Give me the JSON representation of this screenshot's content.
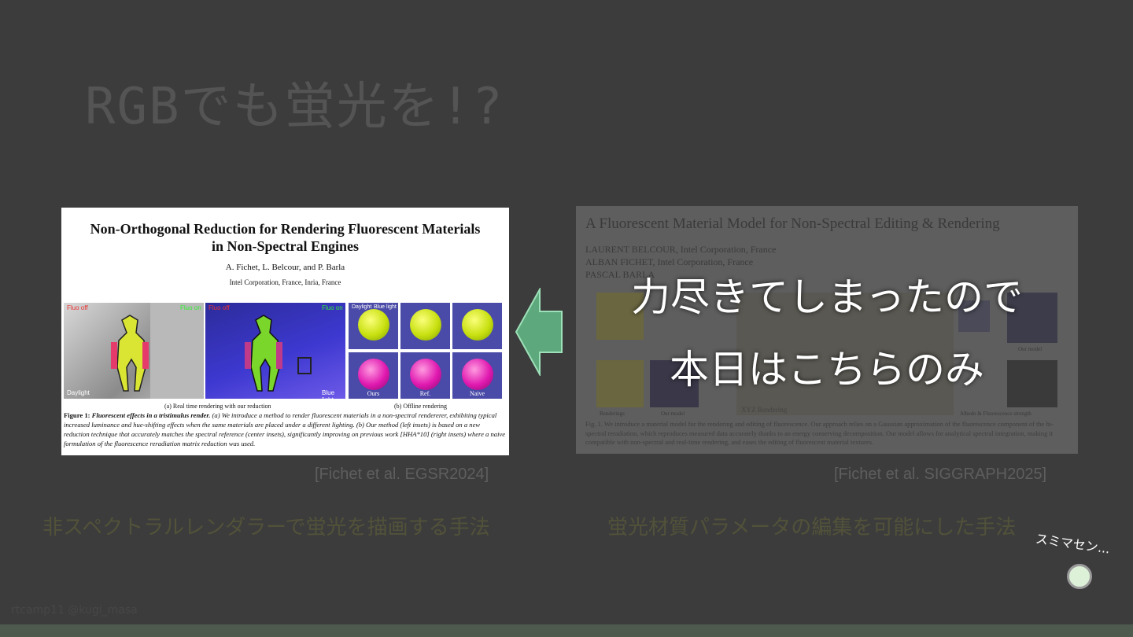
{
  "slide": {
    "title": "RGBでも蛍光を!?",
    "credit": "rtcamp11 @kugi_masa",
    "overlay_line1": "力尽きてしまったので",
    "overlay_line2": "本日はこちらのみ",
    "sorry_note": "スミマセン...",
    "colors": {
      "background": "#3c3c3c",
      "arrow": "#5ea87e",
      "bottom_bar": "#4e5a4e"
    }
  },
  "left_paper": {
    "title_line1": "Non-Orthogonal Reduction for Rendering Fluorescent Materials",
    "title_line2": "in Non-Spectral Engines",
    "authors": "A. Fichet, L. Belcour, and P. Barla",
    "affiliations": "Intel Corporation, France, Inria, France",
    "labels": {
      "fluo_off_a": "Fluo off",
      "fluo_on_a": "Fluo on",
      "fluo_off_b": "Fluo off",
      "fluo_on_b": "Fluo on",
      "daylight": "Daylight",
      "blue_light": "Blue light",
      "ours": "Ours",
      "ref": "Ref.",
      "naive": "Naive",
      "sphere_top_left": "Daylight",
      "sphere_top_right": "Blue light"
    },
    "subcaption_a": "(a) Real time rendering with our reduction",
    "subcaption_b": "(b) Offline rendering",
    "caption_head": "Figure 1:",
    "caption_title": "Fluorescent effects in a tristimulus render.",
    "caption_body": "(a) We introduce a method to render fluorescent materials in a non-spectral rendererer, exhibiting typical increased luminance and hue-shifting effects when the same materials are placed under a different lighting. (b) Our method (left insets) is based on a new reduction technique that accurately matches the spectral reference (center insets), significantly improving on previous work [HHA*10] (right insets) where a naive formulation of the fluorescence reradiation matrix reduction was used.",
    "reference": "[Fichet et al. EGSR2024]",
    "summary": "非スペクトラルレンダラーで蛍光を描画する手法"
  },
  "right_paper": {
    "title": "A Fluorescent Material Model for Non-Spectral Editing & Rendering",
    "author1": "LAURENT BELCOUR, Intel Corporation, France",
    "author2": "ALBAN FICHET, Intel Corporation, France",
    "author3": "PASCAL BARLA",
    "fig_labels": {
      "renderings": "Renderings",
      "our_model": "Our model",
      "xyz": "XYZ Rendering",
      "albedo": "Albedo & Fluorescence strength",
      "our_model_2": "Our model"
    },
    "caption": "Fig. 1. We introduce a material model for the rendering and editing of fluorescence. Our approach relies on a Gaussian approximation of the fluorescence component of the bi-spectral reradiation, which reproduces measured data accurately thanks to an energy conserving decomposition. Our model allows for analytical spectral integration, making it compatible with non-spectral and real-time rendering, and eases the editing of fluorescent material textures.",
    "reference": "[Fichet et al. SIGGRAPH2025]",
    "summary": "蛍光材質パラメータの編集を可能にした手法"
  }
}
